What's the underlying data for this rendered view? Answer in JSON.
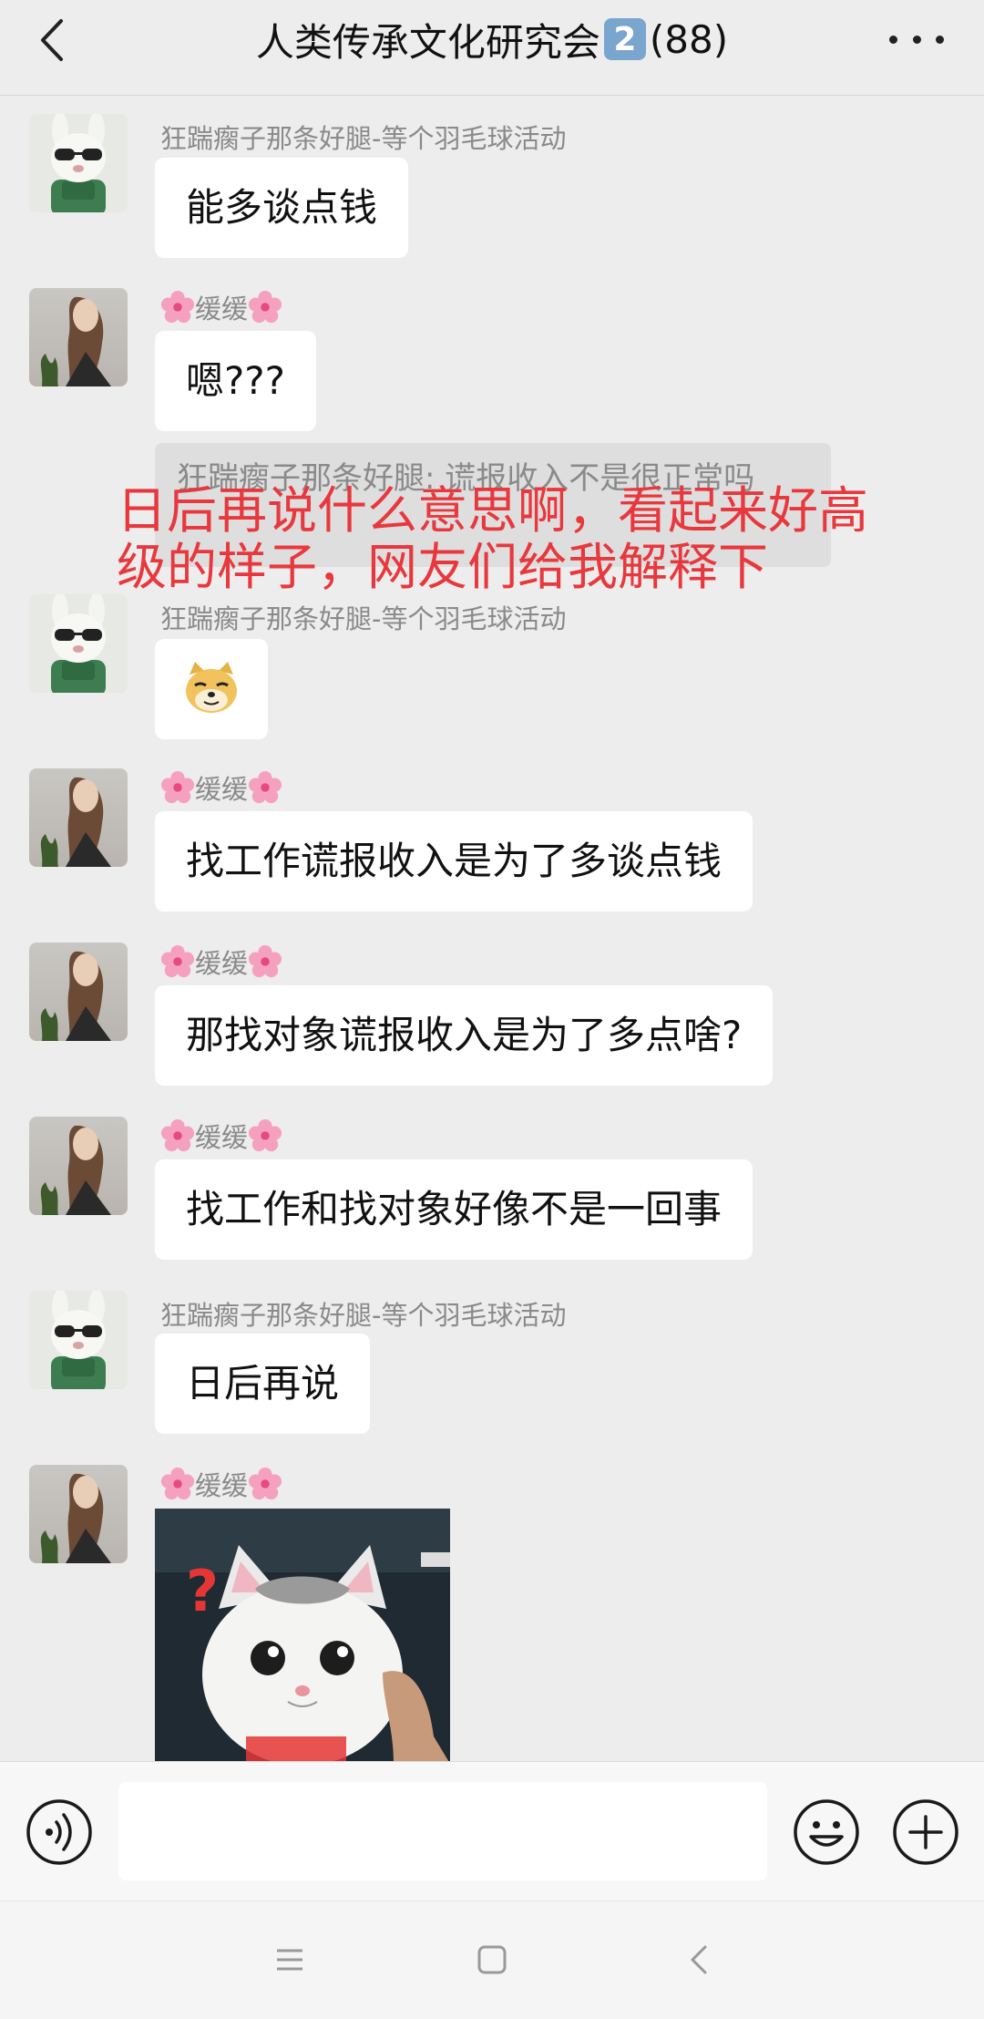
{
  "header": {
    "title": "人类传承文化研究会",
    "badge": "2",
    "member_count": "(88)"
  },
  "overlay_text": {
    "line1": "日后再说什么意思啊，看起来好高",
    "line2": "级的样子，网友们给我解释下"
  },
  "quote": {
    "text": "狂踹瘸子那条好腿: 谎报收入不是很正常吗"
  },
  "messages": [
    {
      "sender": "狂踹瘸子那条好腿-等个羽毛球活动",
      "text": "能多谈点钱",
      "avatar": "bunny-avatar"
    },
    {
      "sender": "缓缓",
      "text": "嗯???",
      "avatar": "girl-avatar"
    },
    {
      "sender": "狂踹瘸子那条好腿-等个羽毛球活动",
      "text": "",
      "avatar": "bunny-avatar",
      "sticker": "doge-emoji"
    },
    {
      "sender": "缓缓",
      "text": "找工作谎报收入是为了多谈点钱",
      "avatar": "girl-avatar"
    },
    {
      "sender": "缓缓",
      "text": "那找对象谎报收入是为了多点啥?",
      "avatar": "girl-avatar"
    },
    {
      "sender": "缓缓",
      "text": "找工作和找对象好像不是一回事",
      "avatar": "girl-avatar"
    },
    {
      "sender": "狂踹瘸子那条好腿-等个羽毛球活动",
      "text": "日后再说",
      "avatar": "bunny-avatar"
    },
    {
      "sender": "缓缓",
      "text": "",
      "avatar": "girl-avatar",
      "image": "cat-sticker"
    }
  ],
  "input": {
    "placeholder": ""
  },
  "colors": {
    "background": "#ededed",
    "overlay_red": "#e8383d",
    "bubble": "#ffffff",
    "sender_gray": "#8a8a8a"
  }
}
